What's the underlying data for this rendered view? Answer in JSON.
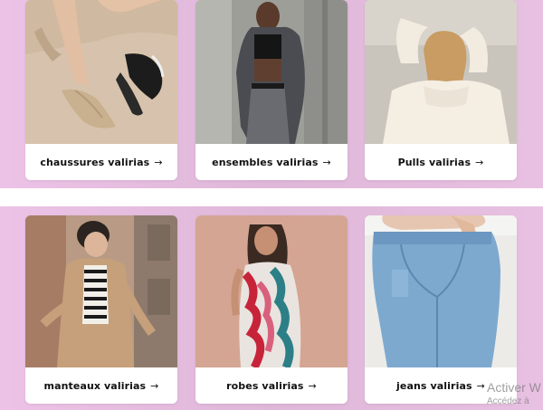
{
  "categories": [
    {
      "label": "chaussures valirias",
      "image": "sandals-photo"
    },
    {
      "label": "ensembles valirias",
      "image": "outfit-photo"
    },
    {
      "label": "Pulls valirias",
      "image": "sweater-photo"
    },
    {
      "label": "manteaux valirias",
      "image": "trench-coat-photo"
    },
    {
      "label": "robes valirias",
      "image": "dress-photo"
    },
    {
      "label": "jeans valirias",
      "image": "jeans-photo"
    }
  ],
  "arrow": "→",
  "watermark": {
    "line1": "Activer W",
    "line2": "Accédez à"
  },
  "colors": {
    "band": "#e4bddf",
    "card": "#ffffff",
    "text": "#111111"
  }
}
